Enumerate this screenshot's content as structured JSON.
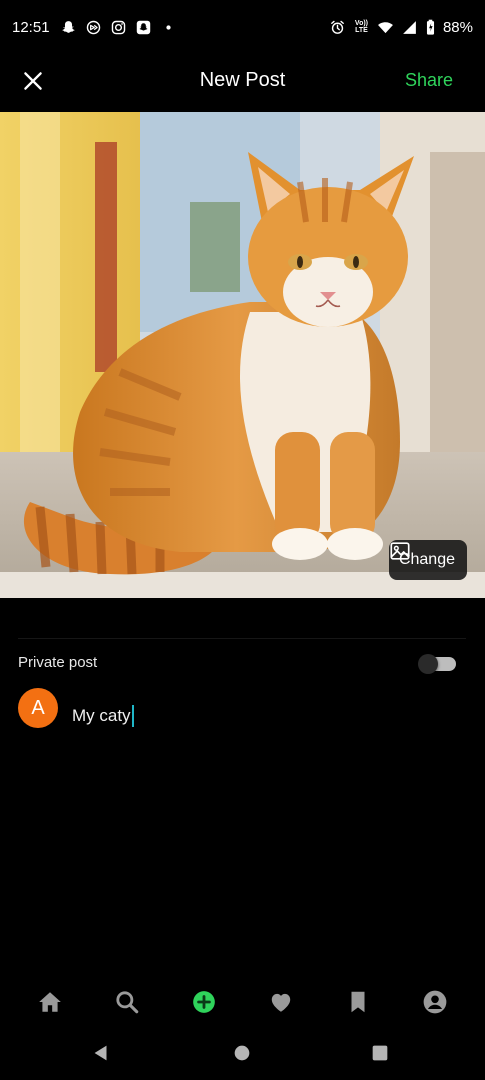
{
  "status_bar": {
    "time": "12:51",
    "volte_top": "Vo))",
    "volte_bottom": "LTE",
    "battery_percent": "88%",
    "notification_icons": [
      "snapchat-icon",
      "sync-icon",
      "instagram-icon",
      "snapchat-icon",
      "dot-icon"
    ],
    "system_icons": [
      "alarm-icon",
      "volte-icon",
      "wifi-icon",
      "signal-icon",
      "battery-icon"
    ]
  },
  "header": {
    "title": "New Post",
    "share_label": "Share",
    "share_color": "#2fd35b"
  },
  "photo": {
    "change_label": "Change"
  },
  "settings": {
    "private_label": "Private post",
    "private_enabled": false
  },
  "caption": {
    "avatar_letter": "A",
    "avatar_color": "#f37012",
    "text": "My caty"
  },
  "bottom_nav": {
    "items": [
      "home-icon",
      "search-icon",
      "add-post-icon",
      "heart-icon",
      "bookmark-icon",
      "profile-icon"
    ],
    "active_color": "#2fd35b"
  },
  "system_nav": {
    "items": [
      "back-icon",
      "home-circle-icon",
      "recents-icon"
    ]
  }
}
